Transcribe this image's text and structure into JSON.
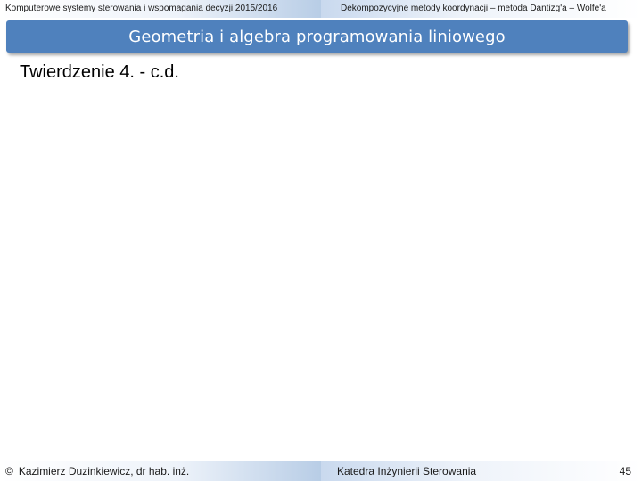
{
  "header": {
    "left": "Komputerowe systemy sterowania i wspomagania decyzji 2015/2016",
    "right": "Dekompozycyjne metody koordynacji – metoda Dantizg'a – Wolfe'a"
  },
  "title_bar": {
    "text": "Geometria i algebra programowania liniowego"
  },
  "content": {
    "heading": "Twierdzenie 4. - c.d."
  },
  "footer": {
    "copyright_symbol": "©",
    "author": "Kazimierz Duzinkiewicz, dr hab. inż.",
    "department": "Katedra Inżynierii Sterowania",
    "page_number": "45"
  },
  "colors": {
    "title_bar": "#4f81bd",
    "band_accent": "#b8cde6"
  }
}
